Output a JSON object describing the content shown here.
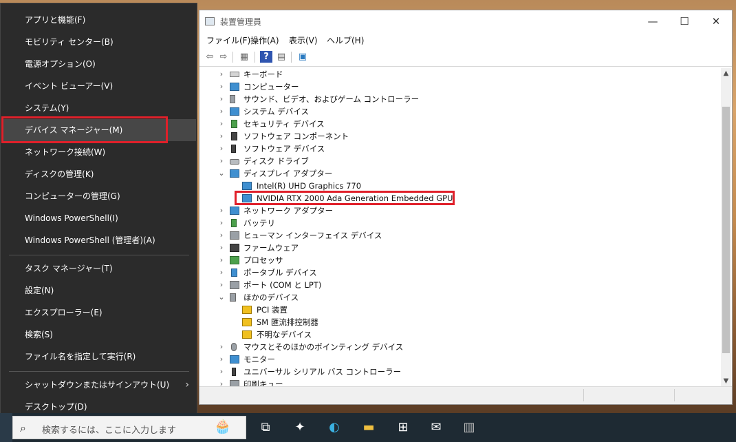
{
  "winx_menu": {
    "items": [
      {
        "label": "アプリと機能(F)"
      },
      {
        "label": "モビリティ センター(B)"
      },
      {
        "label": "電源オプション(O)"
      },
      {
        "label": "イベント ビューアー(V)"
      },
      {
        "label": "システム(Y)"
      },
      {
        "label": "デバイス マネージャー(M)"
      },
      {
        "label": "ネットワーク接続(W)"
      },
      {
        "label": "ディスクの管理(K)"
      },
      {
        "label": "コンピューターの管理(G)"
      },
      {
        "label": "Windows PowerShell(I)"
      },
      {
        "label": "Windows PowerShell (管理者)(A)"
      },
      {
        "label": "タスク マネージャー(T)"
      },
      {
        "label": "設定(N)"
      },
      {
        "label": "エクスプローラー(E)"
      },
      {
        "label": "検索(S)"
      },
      {
        "label": "ファイル名を指定して実行(R)"
      },
      {
        "label": "シャットダウンまたはサインアウト(U)",
        "submenu_icon": "chevron-right-icon"
      },
      {
        "label": "デスクトップ(D)"
      }
    ],
    "highlighted": "デバイス マネージャー(M)"
  },
  "device_manager": {
    "title": "装置管理員",
    "window_controls": {
      "minimize": "—",
      "maximize": "☐",
      "close": "✕"
    },
    "menus": [
      "ファイル(F)",
      "操作(A)",
      "表示(V)",
      "ヘルプ(H)"
    ],
    "toolbar_icons": [
      "back-arrow-icon",
      "forward-arrow-icon",
      "properties-icon",
      "help-icon",
      "console-tree-icon",
      "scan-hardware-icon"
    ],
    "tree": [
      {
        "label": "キーボード",
        "expanded": false,
        "icon": "keyboard-icon"
      },
      {
        "label": "コンピューター",
        "expanded": false,
        "icon": "computer-icon"
      },
      {
        "label": "サウンド、ビデオ、およびゲーム コントローラー",
        "expanded": false,
        "icon": "speaker-icon"
      },
      {
        "label": "システム デバイス",
        "expanded": false,
        "icon": "system-folder-icon"
      },
      {
        "label": "セキュリティ デバイス",
        "expanded": false,
        "icon": "security-chip-icon"
      },
      {
        "label": "ソフトウェア コンポーネント",
        "expanded": false,
        "icon": "software-component-icon"
      },
      {
        "label": "ソフトウェア デバイス",
        "expanded": false,
        "icon": "software-device-icon"
      },
      {
        "label": "ディスク ドライブ",
        "expanded": false,
        "icon": "disk-drive-icon"
      },
      {
        "label": "ディスプレイ アダプター",
        "expanded": true,
        "icon": "display-adapter-icon",
        "children": [
          {
            "label": "Intel(R) UHD Graphics 770",
            "icon": "display-adapter-icon"
          },
          {
            "label": "NVIDIA RTX 2000 Ada Generation Embedded GPU",
            "icon": "display-adapter-icon",
            "highlighted": true
          }
        ]
      },
      {
        "label": "ネットワーク アダプター",
        "expanded": false,
        "icon": "network-adapter-icon"
      },
      {
        "label": "バッテリ",
        "expanded": false,
        "icon": "battery-icon"
      },
      {
        "label": "ヒューマン インターフェイス デバイス",
        "expanded": false,
        "icon": "hid-icon"
      },
      {
        "label": "ファームウェア",
        "expanded": false,
        "icon": "firmware-icon"
      },
      {
        "label": "プロセッサ",
        "expanded": false,
        "icon": "processor-icon"
      },
      {
        "label": "ポータブル デバイス",
        "expanded": false,
        "icon": "portable-device-icon"
      },
      {
        "label": "ポート (COM と LPT)",
        "expanded": false,
        "icon": "port-icon"
      },
      {
        "label": "ほかのデバイス",
        "expanded": true,
        "icon": "other-device-icon",
        "children": [
          {
            "label": "PCI 装置",
            "icon": "warning-device-icon"
          },
          {
            "label": "SM 匯流排控制器",
            "icon": "warning-device-icon"
          },
          {
            "label": "不明なデバイス",
            "icon": "warning-device-icon"
          }
        ]
      },
      {
        "label": "マウスとそのほかのポインティング デバイス",
        "expanded": false,
        "icon": "mouse-icon"
      },
      {
        "label": "モニター",
        "expanded": false,
        "icon": "monitor-icon"
      },
      {
        "label": "ユニバーサル シリアル バス コントローラー",
        "expanded": false,
        "icon": "usb-icon"
      },
      {
        "label": "印刷キュー",
        "expanded": false,
        "icon": "printer-icon"
      }
    ]
  },
  "taskbar": {
    "search_placeholder": "検索するには、ここに入力します",
    "icons": [
      "task-view-icon",
      "copilot-icon",
      "edge-icon",
      "file-explorer-icon",
      "store-icon",
      "mail-icon",
      "device-manager-icon"
    ]
  },
  "colors": {
    "highlight_box": "#e0202a",
    "menu_bg": "#2b2b2b",
    "menu_hover": "#474747"
  }
}
